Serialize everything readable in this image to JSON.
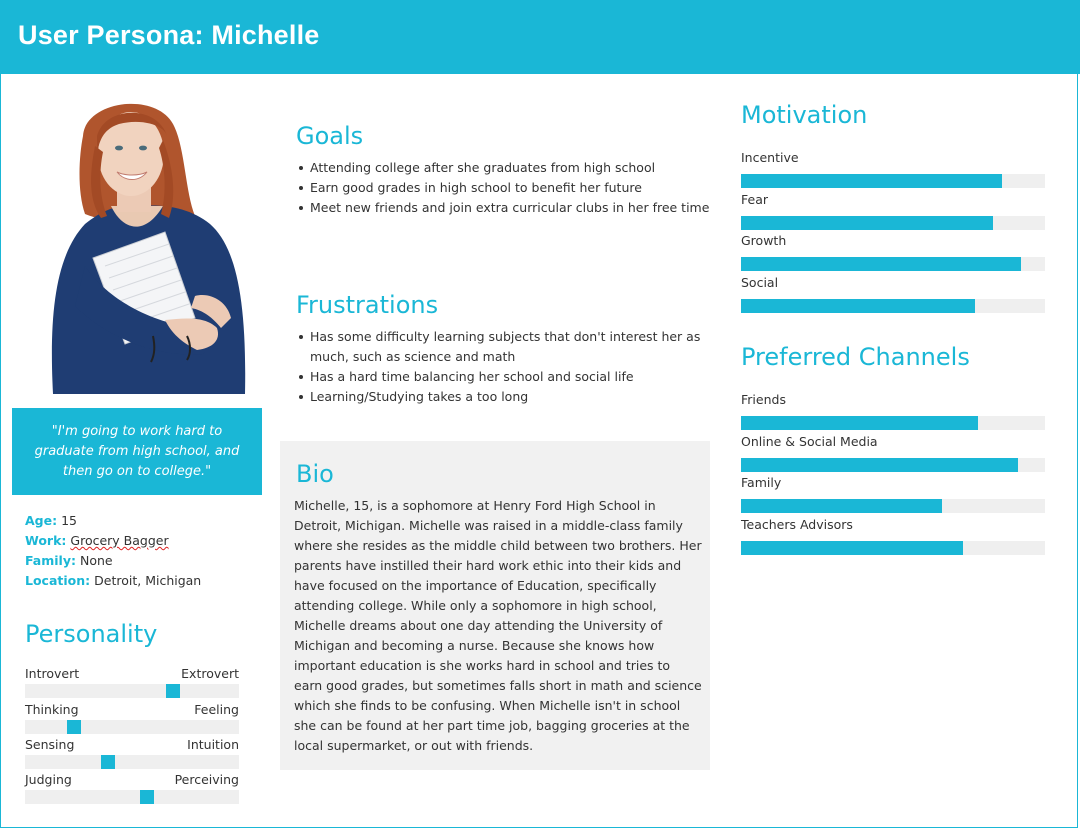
{
  "header": {
    "title": "User Persona: Michelle"
  },
  "colors": {
    "accent": "#1ab7d6",
    "panel": "#f1f1f1",
    "track": "#efefef"
  },
  "quote": "\"I'm going to work hard to graduate from high school, and then go on to college.\"",
  "facts": {
    "age_label": "Age:",
    "age": "15",
    "work_label": "Work:",
    "work": "Grocery Bagger",
    "family_label": "Family:",
    "family": "None",
    "location_label": "Location:",
    "location": "Detroit, Michigan"
  },
  "personality": {
    "title": "Personality",
    "traits": [
      {
        "left": "Introvert",
        "right": "Extrovert",
        "value": 0.69
      },
      {
        "left": "Thinking",
        "right": "Feeling",
        "value": 0.23
      },
      {
        "left": "Sensing",
        "right": "Intuition",
        "value": 0.39
      },
      {
        "left": "Judging",
        "right": "Perceiving",
        "value": 0.57
      }
    ]
  },
  "goals": {
    "title": "Goals",
    "items": [
      "Attending college after she graduates from high school",
      "Earn good grades in high school to benefit her future",
      "Meet new friends and join extra curricular clubs in her free time"
    ]
  },
  "frustrations": {
    "title": "Frustrations",
    "items": [
      "Has some difficulty learning subjects that don't interest her as much, such as science and math",
      "Has a hard time balancing her school and social life",
      "Learning/Studying takes a too long"
    ]
  },
  "bio": {
    "title": "Bio",
    "text": "Michelle, 15,  is a sophomore at Henry Ford High School in Detroit, Michigan. Michelle was raised in a middle-class family where she resides as the middle child between two brothers. Her parents have instilled their hard work ethic into their kids and have focused on the importance of Education, specifically attending college. While only a sophomore in high school, Michelle dreams about one day attending the University of Michigan and becoming a nurse. Because she knows how important education is she works hard in school and tries to earn good grades, but sometimes falls short in math and science which she finds to be confusing. When Michelle isn't in school she can be found at her part time job, bagging groceries at the local supermarket, or out with friends."
  },
  "motivation": {
    "title": "Motivation",
    "items": [
      {
        "label": "Incentive",
        "value": 0.86
      },
      {
        "label": "Fear",
        "value": 0.83
      },
      {
        "label": "Growth",
        "value": 0.92
      },
      {
        "label": "Social",
        "value": 0.77
      }
    ]
  },
  "channels": {
    "title": "Preferred Channels",
    "items": [
      {
        "label": "Friends",
        "value": 0.78
      },
      {
        "label": "Online & Social Media",
        "value": 0.91
      },
      {
        "label": "Family",
        "value": 0.66
      },
      {
        "label": "Teachers  Advisors",
        "value": 0.73
      }
    ]
  }
}
